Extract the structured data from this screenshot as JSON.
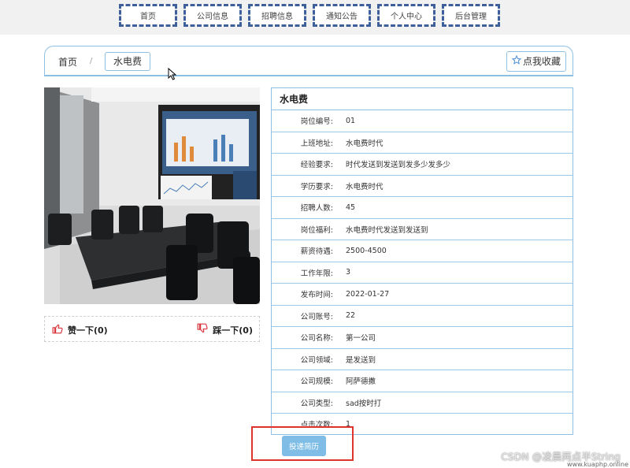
{
  "nav": {
    "items": [
      "首页",
      "公司信息",
      "招聘信息",
      "通知公告",
      "个人中心",
      "后台管理"
    ]
  },
  "breadcrumb": {
    "home": "首页",
    "separator": "/",
    "current": "水电费"
  },
  "favorite_button": {
    "label": "点我收藏",
    "icon": "star-icon"
  },
  "votes": {
    "like": "赞一下(0)",
    "dislike": "踩一下(0)"
  },
  "detail": {
    "title": "水电费",
    "fields": [
      {
        "label": "岗位编号:",
        "value": "01"
      },
      {
        "label": "上班地址:",
        "value": "水电费时代"
      },
      {
        "label": "经验要求:",
        "value": "时代发送到发送到发多少发多少"
      },
      {
        "label": "学历要求:",
        "value": "水电费时代"
      },
      {
        "label": "招聘人数:",
        "value": "45"
      },
      {
        "label": "岗位福利:",
        "value": "水电费时代发送到发送到"
      },
      {
        "label": "薪资待遇:",
        "value": "2500-4500"
      },
      {
        "label": "工作年限:",
        "value": "3"
      },
      {
        "label": "发布时间:",
        "value": "2022-01-27"
      },
      {
        "label": "公司账号:",
        "value": "22"
      },
      {
        "label": "公司名称:",
        "value": "第一公司"
      },
      {
        "label": "公司领域:",
        "value": "是发送到"
      },
      {
        "label": "公司规模:",
        "value": "阿萨德撒"
      },
      {
        "label": "公司类型:",
        "value": "sad按时打"
      },
      {
        "label": "点击次数:",
        "value": "1"
      }
    ]
  },
  "apply_button": "投递简历",
  "watermark": "CSDN @凌晨两点半String",
  "watermark_url": "www.kuaphp.online",
  "colors": {
    "accent_border": "#8fc0e3",
    "nav_border": "#3d5f9a",
    "apply_button": "#7fbde6",
    "highlight": "#e0322d"
  }
}
